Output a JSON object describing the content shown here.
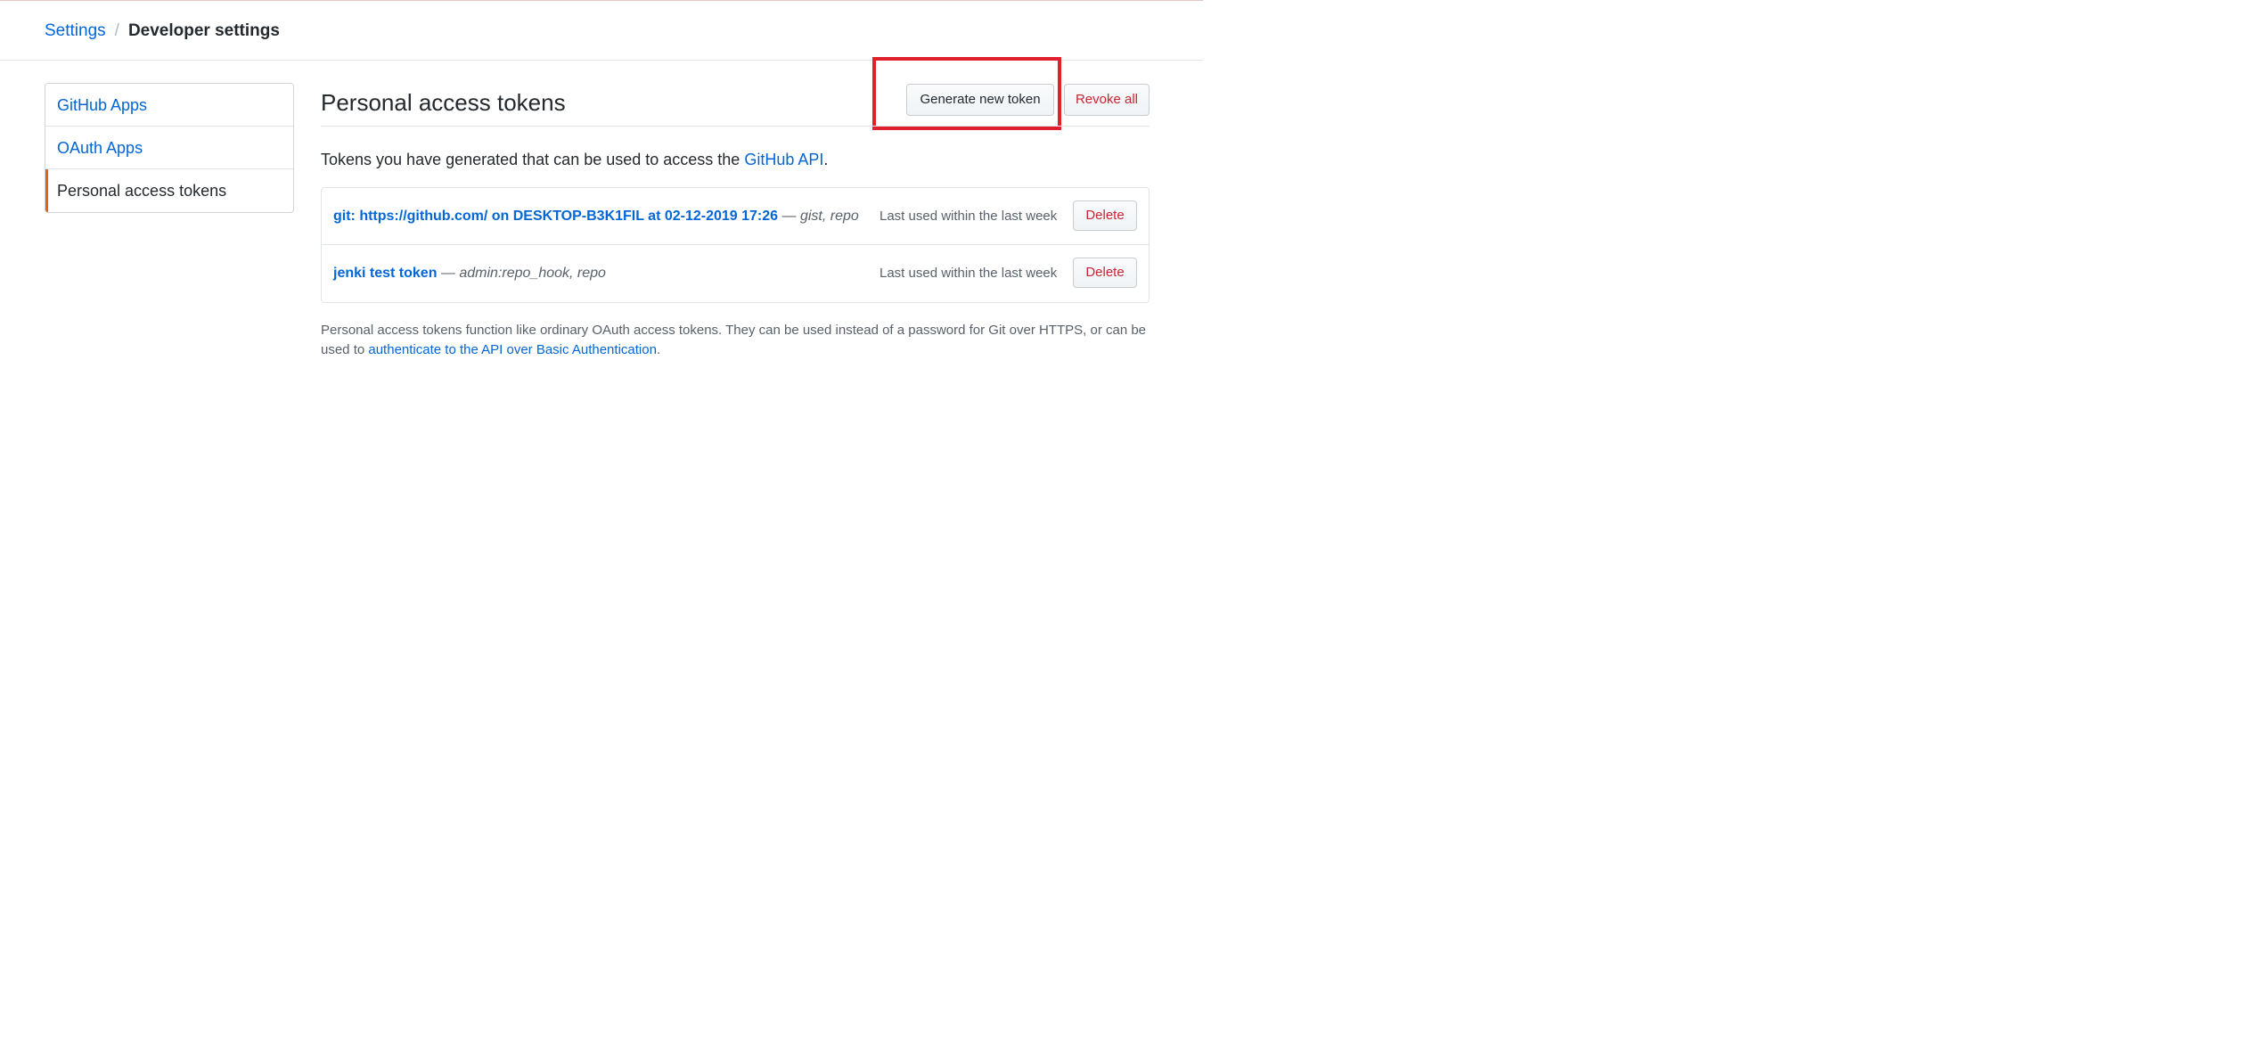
{
  "breadcrumb": {
    "parent": "Settings",
    "separator": "/",
    "current": "Developer settings"
  },
  "sidebar": {
    "items": [
      {
        "label": "GitHub Apps",
        "active": false
      },
      {
        "label": "OAuth Apps",
        "active": false
      },
      {
        "label": "Personal access tokens",
        "active": true
      }
    ]
  },
  "main": {
    "title": "Personal access tokens",
    "generate_label": "Generate new token",
    "revoke_label": "Revoke all",
    "intro_prefix": "Tokens you have generated that can be used to access the ",
    "intro_link": "GitHub API",
    "intro_suffix": ".",
    "tokens": [
      {
        "name": "git: https://github.com/ on DESKTOP-B3K1FIL at 02-12-2019 17:26",
        "dash": " — ",
        "scopes": "gist, repo",
        "last_used": "Last used within the last week",
        "delete_label": "Delete"
      },
      {
        "name": "jenki test token",
        "dash": " — ",
        "scopes": "admin:repo_hook, repo",
        "last_used": "Last used within the last week",
        "delete_label": "Delete"
      }
    ],
    "note_text": "Personal access tokens function like ordinary OAuth access tokens. They can be used instead of a password for Git over HTTPS, or can be used to ",
    "note_link": "authenticate to the API over Basic Authentication",
    "note_suffix": "."
  },
  "colors": {
    "link": "#0366d6",
    "danger": "#cb2431",
    "active_indicator": "#e36209",
    "highlight_box": "#e0202c"
  }
}
